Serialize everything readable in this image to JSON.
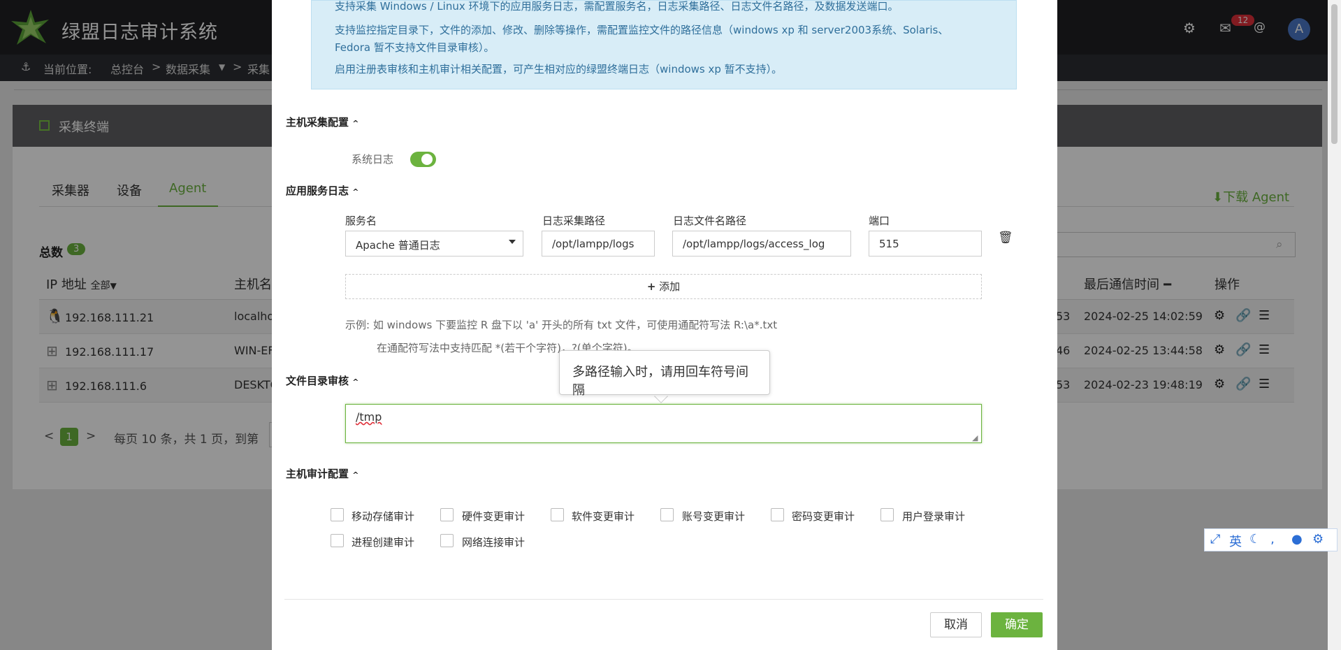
{
  "header": {
    "app_title": "绿盟日志审计系统",
    "mail_count": "12",
    "at_symbol": "@",
    "avatar_letter": "A",
    "icons": [
      "settings-cogs-icon",
      "mail-icon"
    ]
  },
  "breadcrumb": {
    "anchor_icon": "⚓",
    "label": "当前位置:",
    "items": [
      "总控台",
      "数据采集",
      "采集"
    ]
  },
  "panel": {
    "title": "采集终端",
    "tabs": [
      "采集器",
      "设备",
      "Agent"
    ],
    "active_tab": "Agent",
    "download_label": "下载 Agent",
    "total_label": "总数",
    "total_count": "3"
  },
  "table": {
    "headers": {
      "ip": "IP 地址",
      "ip_filter": "全部",
      "hostname": "主机名",
      "last_comm": "最后通信时间",
      "actions": "操作"
    },
    "rows": [
      {
        "os": "linux",
        "ip": "192.168.111.21",
        "host": "localho",
        "tail": "53",
        "time": "2024-02-25 14:02:59"
      },
      {
        "os": "windows",
        "ip": "192.168.111.17",
        "host": "WIN-EF",
        "tail": "46",
        "time": "2024-02-25 13:44:58"
      },
      {
        "os": "windows",
        "ip": "192.168.111.6",
        "host": "DESKTO",
        "tail": "53",
        "time": "2024-02-23 19:48:19"
      }
    ]
  },
  "pager": {
    "prev": "<",
    "current": "1",
    "next": ">",
    "summary": "每页 10 条，共 1 页，到第"
  },
  "modal": {
    "info_lines": [
      "支持采集 Windows / Linux 环境下的应用服务日志，需配置服务名，日志采集路径、日志文件名路径，及数据发送端口。",
      "支持监控指定目录下，文件的添加、修改、删除等操作，需配置监控文件的路径信息（windows xp 和 server2003系统、Solaris、",
      "Fedora 暂不支持文件目录审核）。",
      "启用注册表审核和主机审计相关配置，可产生相对应的绿盟终端日志（windows xp 暂不支持）。"
    ],
    "sections": {
      "host_collect": "主机采集配置",
      "app_log": "应用服务日志",
      "file_audit": "文件目录审核",
      "host_audit": "主机审计配置"
    },
    "syslog_label": "系统日志",
    "syslog_enabled": true,
    "fields": {
      "service_label": "服务名",
      "service_value": "Apache 普通日志",
      "log_path_label": "日志采集路径",
      "log_path_value": "/opt/lampp/logs",
      "log_file_label": "日志文件名路径",
      "log_file_value": "/opt/lampp/logs/access_log",
      "port_label": "端口",
      "port_value": "515"
    },
    "add_label": "添加",
    "example_line1": "示例:  如 windows 下要监控 R 盘下以 'a' 开头的所有 txt 文件，可使用通配符写法 R:\\a*.txt",
    "example_line2": "在通配符写法中支持匹配 *(若干个字符)，?(单个字符)。",
    "tooltip": "多路径输入时，请用回车符号间隔",
    "file_audit_value": "/tmp",
    "audit_options": [
      "移动存储审计",
      "硬件变更审计",
      "软件变更审计",
      "账号变更审计",
      "密码变更审计",
      "用户登录审计",
      "进程创建审计",
      "网络连接审计"
    ],
    "cancel_label": "取消",
    "ok_label": "确定"
  },
  "ime": {
    "lang": "英"
  }
}
